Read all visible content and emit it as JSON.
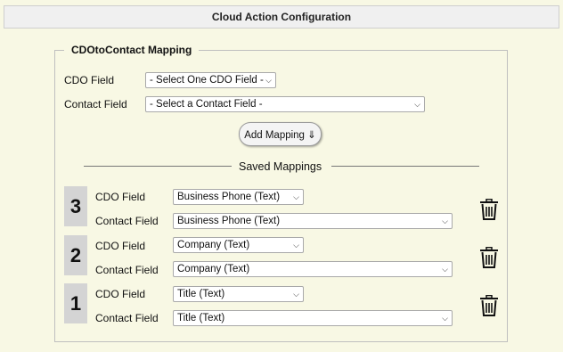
{
  "title": "Cloud Action Configuration",
  "mapping": {
    "legend": "CDOtoContact Mapping",
    "cdo_label": "CDO Field",
    "cdo_placeholder": "- Select One CDO Field -",
    "contact_label": "Contact Field",
    "contact_placeholder": "- Select a Contact Field -",
    "add_button": "Add Mapping ⇓"
  },
  "saved": {
    "title": "Saved Mappings",
    "cdo_label": "CDO Field",
    "contact_label": "Contact Field",
    "rows": [
      {
        "number": "3",
        "cdo_value": "Business Phone (Text)",
        "contact_value": "Business Phone (Text)"
      },
      {
        "number": "2",
        "cdo_value": "Company (Text)",
        "contact_value": "Company (Text)"
      },
      {
        "number": "1",
        "cdo_value": "Title (Text)",
        "contact_value": "Title (Text)"
      }
    ]
  },
  "icons": {
    "dropdown": "chevron-down-icon",
    "delete": "trash-icon"
  }
}
